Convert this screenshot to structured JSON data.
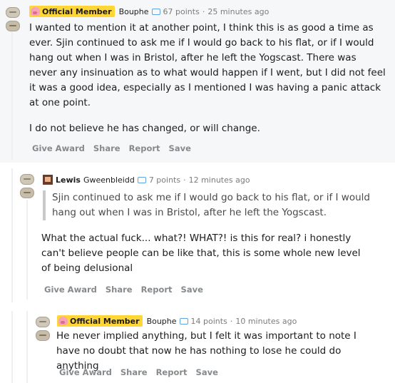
{
  "comments": [
    {
      "flair": "Official Member",
      "username": "Bouphe",
      "points": "67 points",
      "time": "25 minutes ago",
      "paragraphs": [
        "I wanted to mention it at another point, I think this is as good a time as ever. Sjin continued to ask me if I would go back to his flat, or if I would hang out when I was in Bristol, after he left the Yogscast. There was never any insinuation as to what would happen if I went, but I did not feel it was a good idea, especially as I mentioned I was having a panic attack at one point.",
        "I do not believe he has changed, or will change."
      ],
      "actions": [
        "Give Award",
        "Share",
        "Report",
        "Save"
      ]
    },
    {
      "username": "Lewis",
      "flair_text": "Gweenbleidd",
      "points": "7 points",
      "time": "12 minutes ago",
      "quote": "Sjin continued to ask me if I would go back to his flat, or if I would hang out when I was in Bristol, after he left the Yogscast.",
      "text": "What the actual fuck... what?! WHAT?! is this for real? i honestly can't believe people can be like that, this is some whole new level of being delusional",
      "actions": [
        "Give Award",
        "Share",
        "Report",
        "Save"
      ]
    },
    {
      "flair": "Official Member",
      "username": "Bouphe",
      "points": "14 points",
      "time": "10 minutes ago",
      "text": "He never implied anything, but I felt it was important to note I have no doubt that now he has nothing to lose he could do anything",
      "actions": [
        "Give Award",
        "Share",
        "Report",
        "Save"
      ]
    }
  ],
  "icons": {
    "vote": "upvote-downvote-icon",
    "badge": "achievement-badge-icon",
    "flair": "pig-flair-icon",
    "avatar": "lewis-avatar-icon"
  },
  "colors": {
    "flair_bg": "#ffd635",
    "badge": "#5fa3e0",
    "action_text": "#878a8c",
    "highlight_bg": "#f6f7f8"
  }
}
